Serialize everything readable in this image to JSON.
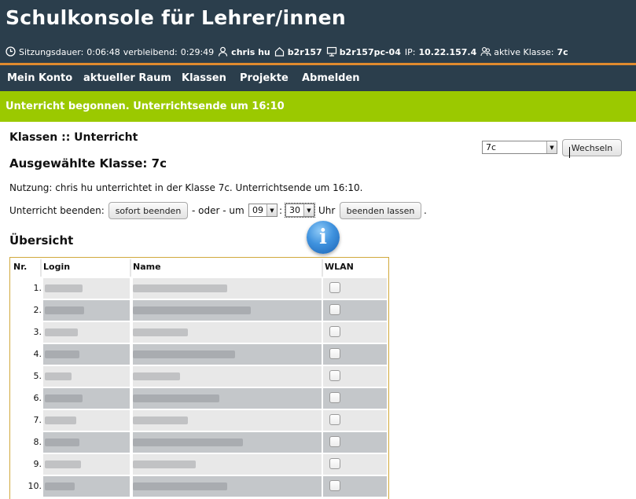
{
  "app": {
    "title": "Schulkonsole für Lehrer/innen"
  },
  "session": {
    "duration_label": "Sitzungsdauer:",
    "duration": "0:06:48",
    "remaining_label": "verbleibend:",
    "remaining": "0:29:49",
    "user": "chris hu",
    "room": "b2r157",
    "host": "b2r157pc-04",
    "ip_label": "IP:",
    "ip": "10.22.157.4",
    "class_label": "aktive Klasse:",
    "class": "7c"
  },
  "nav": {
    "items": [
      {
        "label": "Mein Konto"
      },
      {
        "label": "aktueller Raum"
      },
      {
        "label": "Klassen"
      },
      {
        "label": "Projekte"
      },
      {
        "label": "Abmelden"
      }
    ]
  },
  "banner": {
    "message": "Unterricht begonnen. Unterrichtsende um 16:10"
  },
  "content": {
    "breadcrumb": "Klassen :: Unterricht",
    "selected_class_heading": "Ausgewählte Klasse: 7c",
    "usage_text": "Nutzung: chris hu unterrichtet in der Klasse 7c. Unterrichtsende um 16:10.",
    "end_label": "Unterricht beenden:",
    "end_now_button": "sofort beenden",
    "or_at_label": "- oder - um",
    "hour_value": "09",
    "colon": ":",
    "minute_value": "30",
    "uhr_label": "Uhr",
    "end_at_button": "beenden lassen",
    "period": ".",
    "overview_heading": "Übersicht",
    "class_select_value": "7c",
    "switch_button": "Wechseln"
  },
  "table": {
    "columns": {
      "nr": "Nr.",
      "login": "Login",
      "name": "Name",
      "wlan": "WLAN"
    },
    "rows": [
      {
        "nr": "1."
      },
      {
        "nr": "2."
      },
      {
        "nr": "3."
      },
      {
        "nr": "4."
      },
      {
        "nr": "5."
      },
      {
        "nr": "6."
      },
      {
        "nr": "7."
      },
      {
        "nr": "8."
      },
      {
        "nr": "9."
      },
      {
        "nr": "10."
      }
    ]
  },
  "colors": {
    "header_bg": "#2b3e4c",
    "accent_orange": "#e08a2e",
    "banner_green": "#9bc900",
    "table_border": "#d1a93c",
    "row_light": "#e8e8e8",
    "row_dark": "#c4c7ca"
  }
}
